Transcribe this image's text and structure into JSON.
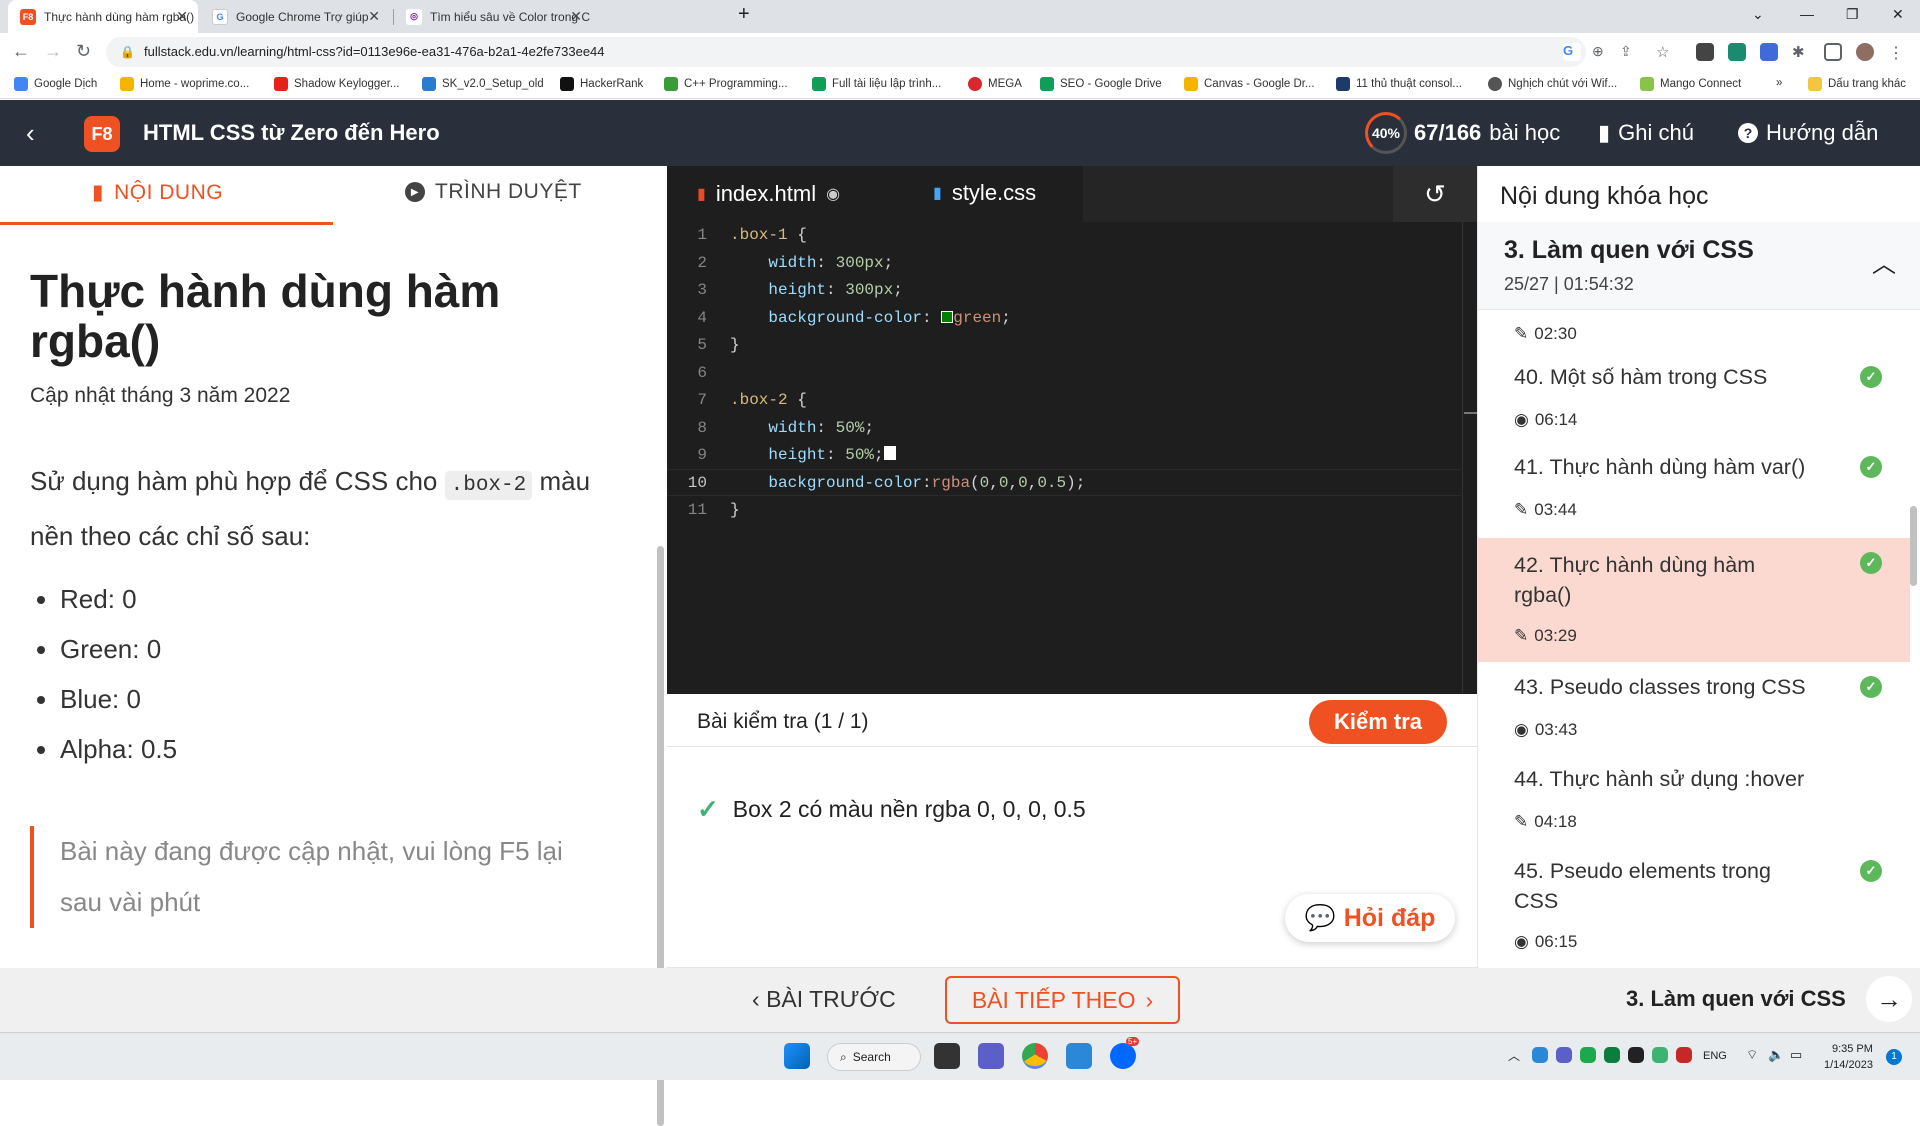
{
  "browser": {
    "tabs": [
      {
        "title": "Thực hành dùng hàm rgba()",
        "favicon": "F8"
      },
      {
        "title": "Google Chrome Trợ giúp",
        "favicon": "G"
      },
      {
        "title": "Tìm hiểu sâu về Color trong CSS",
        "favicon": "◎"
      }
    ],
    "url": "fullstack.edu.vn/learning/html-css?id=0113e96e-ea31-476a-b2a1-4e2fe733ee44",
    "bookmarks": [
      "Google Dịch",
      "Home - woprime.co...",
      "Shadow Keylogger...",
      "SK_v2.0_Setup_old",
      "HackerRank",
      "C++ Programming...",
      "Full tài liệu lập trình...",
      "MEGA",
      "SEO - Google Drive",
      "Canvas - Google Dr...",
      "11 thủ thuật consol...",
      "Nghịch chút với Wif...",
      "Mango Connect"
    ],
    "bookmarks_more": "»",
    "bookmarks_folder": "Dấu trang khác"
  },
  "header": {
    "logo": "F8",
    "course_title": "HTML CSS từ Zero đến Hero",
    "progress_percent": "40%",
    "progress_count": "67/166",
    "progress_unit": "bài học",
    "notes": "Ghi chú",
    "guide": "Hướng dẫn"
  },
  "left": {
    "tab_content": "NỘI DUNG",
    "tab_browser": "TRÌNH DUYỆT",
    "title": "Thực hành dùng hàm rgba()",
    "updated": "Cập nhật tháng 3 năm 2022",
    "task_before": "Sử dụng hàm phù hợp để CSS cho",
    "task_code": ".box-2",
    "task_after": "màu nền theo các chỉ số sau:",
    "bullets": [
      "Red: 0",
      "Green: 0",
      "Blue: 0",
      "Alpha: 0.5"
    ],
    "notice": "Bài này đang được cập nhật, vui lòng F5 lại sau vài phút"
  },
  "editor": {
    "tabs": [
      "index.html",
      "style.css"
    ],
    "line_numbers": [
      "1",
      "2",
      "3",
      "4",
      "5",
      "6",
      "7",
      "8",
      "9",
      "10",
      "11"
    ]
  },
  "test": {
    "title": "Bài kiểm tra (1 / 1)",
    "check_button": "Kiểm tra",
    "result": "Box 2 có màu nền rgba 0, 0, 0, 0.5",
    "qa_button": "Hỏi đáp"
  },
  "sidebar": {
    "title": "Nội dung khóa học",
    "section_title": "3. Làm quen với CSS",
    "section_meta": "25/27 | 01:54:32",
    "lessons": [
      {
        "title": "",
        "duration": "02:30"
      },
      {
        "title": "40. Một số hàm trong CSS",
        "duration": "06:14"
      },
      {
        "title": "41. Thực hành dùng hàm var()",
        "duration": "03:44"
      },
      {
        "title": "42. Thực hành dùng hàm rgba()",
        "duration": "03:29"
      },
      {
        "title": "43. Pseudo classes trong CSS",
        "duration": "03:43"
      },
      {
        "title": "44. Thực hành sử dụng :hover",
        "duration": "04:18"
      },
      {
        "title": "45. Pseudo elements trong CSS",
        "duration": "06:15"
      }
    ]
  },
  "footer": {
    "prev": "BÀI TRƯỚC",
    "next": "BÀI TIẾP THEO",
    "section": "3. Làm quen với CSS"
  },
  "taskbar": {
    "search": "Search",
    "lang": "ENG",
    "time": "9:35 PM",
    "date": "1/14/2023",
    "notif": "1",
    "zalo_badge": "5+"
  },
  "colors": {
    "accent": "#f05123",
    "header_bg": "#29303b",
    "editor_bg": "#1e1e1e",
    "success": "#5db85c",
    "active_lesson": "#fcd9d0"
  }
}
